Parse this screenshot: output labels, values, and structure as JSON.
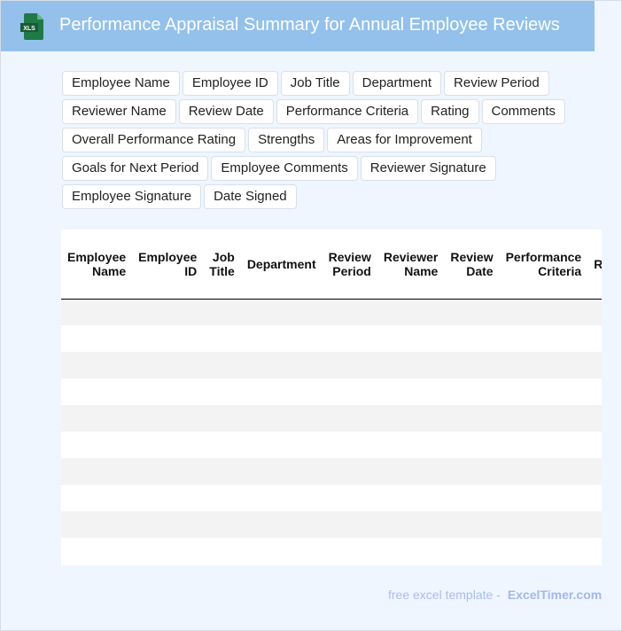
{
  "header": {
    "title": "Performance Appraisal Summary for Annual Employee Reviews",
    "icon": "xls-file-icon",
    "icon_text": "XLS",
    "color": "#93c1ec"
  },
  "tags": [
    "Employee Name",
    "Employee ID",
    "Job Title",
    "Department",
    "Review Period",
    "Reviewer Name",
    "Review Date",
    "Performance Criteria",
    "Rating",
    "Comments",
    "Overall Performance Rating",
    "Strengths",
    "Areas for Improvement",
    "Goals for Next Period",
    "Employee Comments",
    "Reviewer Signature",
    "Employee Signature",
    "Date Signed"
  ],
  "table": {
    "columns": [
      [
        "Employee",
        "Name"
      ],
      [
        "Employee",
        "ID"
      ],
      [
        "Job",
        "Title"
      ],
      [
        "Department"
      ],
      [
        "Review",
        "Period"
      ],
      [
        "Reviewer",
        "Name"
      ],
      [
        "Review",
        "Date"
      ],
      [
        "Performance",
        "Criteria"
      ],
      [
        "Rating"
      ]
    ],
    "row_count": 10
  },
  "footer": {
    "text": "free excel template -",
    "brand": "ExcelTimer.com"
  }
}
